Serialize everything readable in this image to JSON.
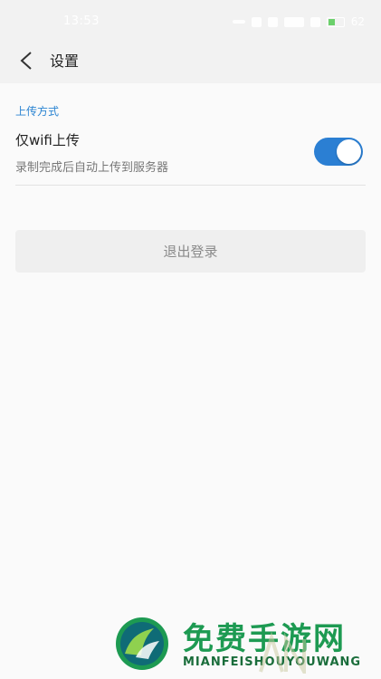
{
  "status_bar": {
    "time": "13:53",
    "battery_percent": "62",
    "icons": [
      "notification-dots-icon",
      "bluetooth-icon",
      "alarm-icon",
      "signal-icon",
      "wifi-icon",
      "battery-icon"
    ]
  },
  "header": {
    "back_icon": "chevron-left-icon",
    "title": "设置"
  },
  "upload_section": {
    "header": "上传方式",
    "wifi_only": {
      "title": "仅wifi上传",
      "description": "录制完成后自动上传到服务器",
      "enabled": true
    }
  },
  "logout": {
    "label": "退出登录"
  },
  "watermark": {
    "title": "免费手游网",
    "subtitle": "MIANFEISHOUYOUWANG"
  },
  "colors": {
    "accent": "#2b84d2",
    "toggle_on": "#2b7fd3",
    "background": "#fafafa",
    "header_bg": "#f2f2f2"
  }
}
